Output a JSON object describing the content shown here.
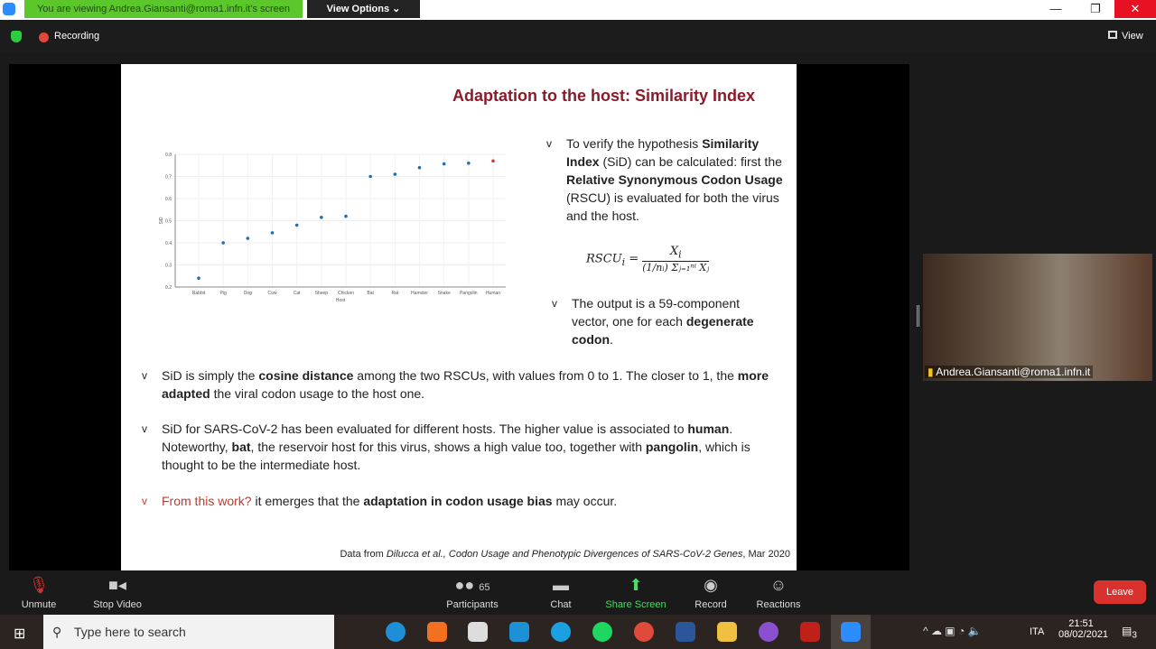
{
  "banner": {
    "text": "You are viewing Andrea.Giansanti@roma1.infn.it's screen",
    "view_options": "View Options ⌄"
  },
  "window": {
    "minimize": "—",
    "restore": "❐",
    "close": "✕"
  },
  "status": {
    "recording": "Recording",
    "view": "View"
  },
  "slide": {
    "title": "Adaptation to the host: Similarity Index",
    "bullet1_parts": [
      "To verify the hypothesis ",
      "Similarity Index",
      " (SiD) can be calculated: first the ",
      "Relative Synonymous Codon Usage",
      " (RSCU) is evaluated for both the virus and the host."
    ],
    "formula_lhs": "RSCU",
    "formula_sub": "i",
    "formula_num": "X",
    "formula_den": "(1/nᵢ) Σⱼ₌₁ⁿⁱ Xⱼ",
    "bullet2_parts": [
      "The output is a 59-component vector, one for each ",
      "degenerate codon",
      "."
    ],
    "bullet3_parts": [
      "SiD is simply the ",
      "cosine distance",
      " among the two RSCUs, with values from 0 to 1. The closer to 1, the ",
      "more adapted",
      " the viral codon usage to the host one."
    ],
    "bullet4_parts": [
      "SiD for SARS-CoV-2 has been evaluated for different hosts. The higher value is associated to ",
      "human",
      ". Noteworthy, ",
      "bat",
      ", the reservoir host for this virus, shows a high value too, together with ",
      "pangolin",
      ", which is thought to be the intermediate host."
    ],
    "bullet5_parts": [
      "From this work?",
      " it emerges that the ",
      "adaptation in codon usage bias",
      " may occur."
    ],
    "bullet_marker": "v",
    "citation_parts": [
      "Data from ",
      "Dilucca et al., Codon Usage and Phenotypic Divergences of SARS-CoV-2 Genes",
      ", Mar 2020"
    ]
  },
  "chart_data": {
    "type": "scatter",
    "xlabel": "Host",
    "ylabel": "SiD",
    "categories": [
      "Rabbit",
      "Pig",
      "Dog",
      "Cow",
      "Cat",
      "Sheep",
      "Chicken",
      "Bat",
      "Rat",
      "Hamster",
      "Snake",
      "Pangolin",
      "Human"
    ],
    "values": [
      0.24,
      0.4,
      0.42,
      0.445,
      0.48,
      0.515,
      0.52,
      0.7,
      0.71,
      0.74,
      0.757,
      0.76,
      0.77
    ],
    "highlight": "Human",
    "point_color": "#1f6fb5",
    "highlight_color": "#e03030",
    "ylim": [
      0.2,
      0.8
    ],
    "yticks": [
      "0.2",
      "0.3",
      "0.4",
      "0.5",
      "0.6",
      "0.7",
      "0.8"
    ],
    "grid": true
  },
  "video": {
    "name": "Andrea.Giansanti@roma1.infn.it"
  },
  "toolbar": {
    "unmute": "Unmute",
    "stop_video": "Stop Video",
    "participants": "Participants",
    "participants_count": "65",
    "chat": "Chat",
    "share": "Share Screen",
    "record": "Record",
    "reactions": "Reactions",
    "leave": "Leave"
  },
  "taskbar": {
    "search": "Type here to search",
    "lang": "ITA",
    "time": "21:51",
    "date": "08/02/2021",
    "notifications": "3"
  }
}
